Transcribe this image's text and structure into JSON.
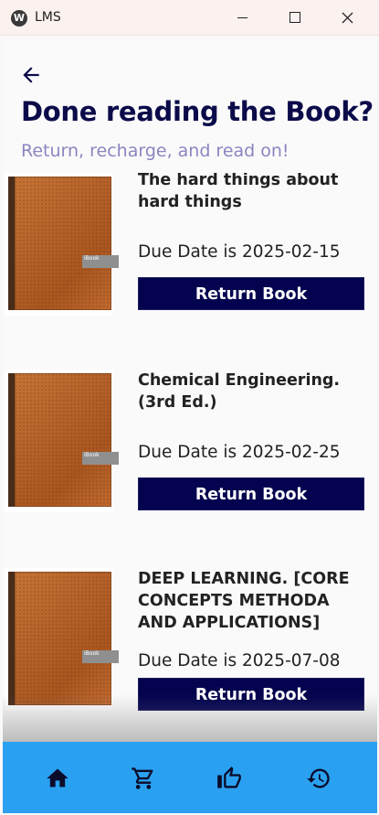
{
  "window": {
    "title": "LMS",
    "app_icon_letter": "W"
  },
  "header": {
    "title": "Done reading the Book?",
    "subtitle": "Return, recharge, and read on!"
  },
  "books": [
    {
      "title": "The hard things about hard things",
      "due_label": "Due Date is 2025-02-15",
      "button_label": "Return Book",
      "cover_label": "iBook"
    },
    {
      "title": "Chemical Engineering. (3rd Ed.)",
      "due_label": "Due Date is 2025-02-25",
      "button_label": "Return Book",
      "cover_label": "iBook"
    },
    {
      "title": "DEEP LEARNING. [CORE CONCEPTS METHODA AND APPLICATIONS]",
      "due_label": "Due Date is 2025-07-08",
      "button_label": "Return Book",
      "cover_label": "iBook"
    }
  ],
  "nav": {
    "items": [
      "home-icon",
      "cart-icon",
      "thumbs-up-icon",
      "history-icon"
    ]
  },
  "colors": {
    "title": "#0b0b4a",
    "subtitle": "#8a86c0",
    "button": "#03034f",
    "nav_bar": "#2aa0f0"
  }
}
